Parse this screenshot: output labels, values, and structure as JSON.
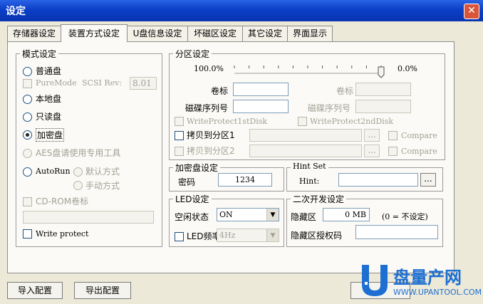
{
  "window": {
    "title": "设定",
    "close_label": "✕"
  },
  "tabs": [
    "存储器设定",
    "装置方式设定",
    "U盘信息设定",
    "坏磁区设定",
    "其它设定",
    "界面显示"
  ],
  "mode": {
    "legend": "模式设定",
    "normal": "普通盘",
    "puremode": "PureMode",
    "scsi_rev_label": "SCSI Rev:",
    "scsi_rev_value": "8.01",
    "local": "本地盘",
    "readonly": "只读盘",
    "encrypted": "加密盘",
    "aes": "AES盘请使用专用工具",
    "autorun": "AutoRun",
    "default_mode": "默认方式",
    "manual_mode": "手动方式",
    "cdrom_label": "CD-ROM卷标",
    "write_protect": "Write protect"
  },
  "partition": {
    "legend": "分区设定",
    "left_pct": "100.0%",
    "right_pct": "0.0%",
    "slider_value": 1.0,
    "volume_label": "卷标",
    "serial_label": "磁碟序列号",
    "wp1": "WriteProtect1stDisk",
    "wp2": "WriteProtect2ndDisk",
    "copy1": "拷贝到分区1",
    "copy2": "拷贝到分区2",
    "compare": "Compare",
    "browse": "..."
  },
  "encrypt": {
    "legend": "加密盘设定",
    "password_label": "密码",
    "password_value": "1234"
  },
  "hint": {
    "legend": "Hint Set",
    "label": "Hint:",
    "browse": "..."
  },
  "led": {
    "legend": "LED设定",
    "idle_label": "空闲状态",
    "idle_value": "ON",
    "freq_label": "LED频率",
    "freq_value": "4Hz"
  },
  "dev": {
    "legend": "二次开发设定",
    "hidden_label": "隐藏区",
    "hidden_value": "0",
    "hidden_unit": "MB",
    "hidden_note": "(0 = 不设定)",
    "auth_label": "隐藏区授权码"
  },
  "buttons": {
    "import": "导入配置",
    "export": "导出配置"
  },
  "watermark": {
    "brand": "盘量产网",
    "url": "WWW.UPANTOOL.COM"
  }
}
